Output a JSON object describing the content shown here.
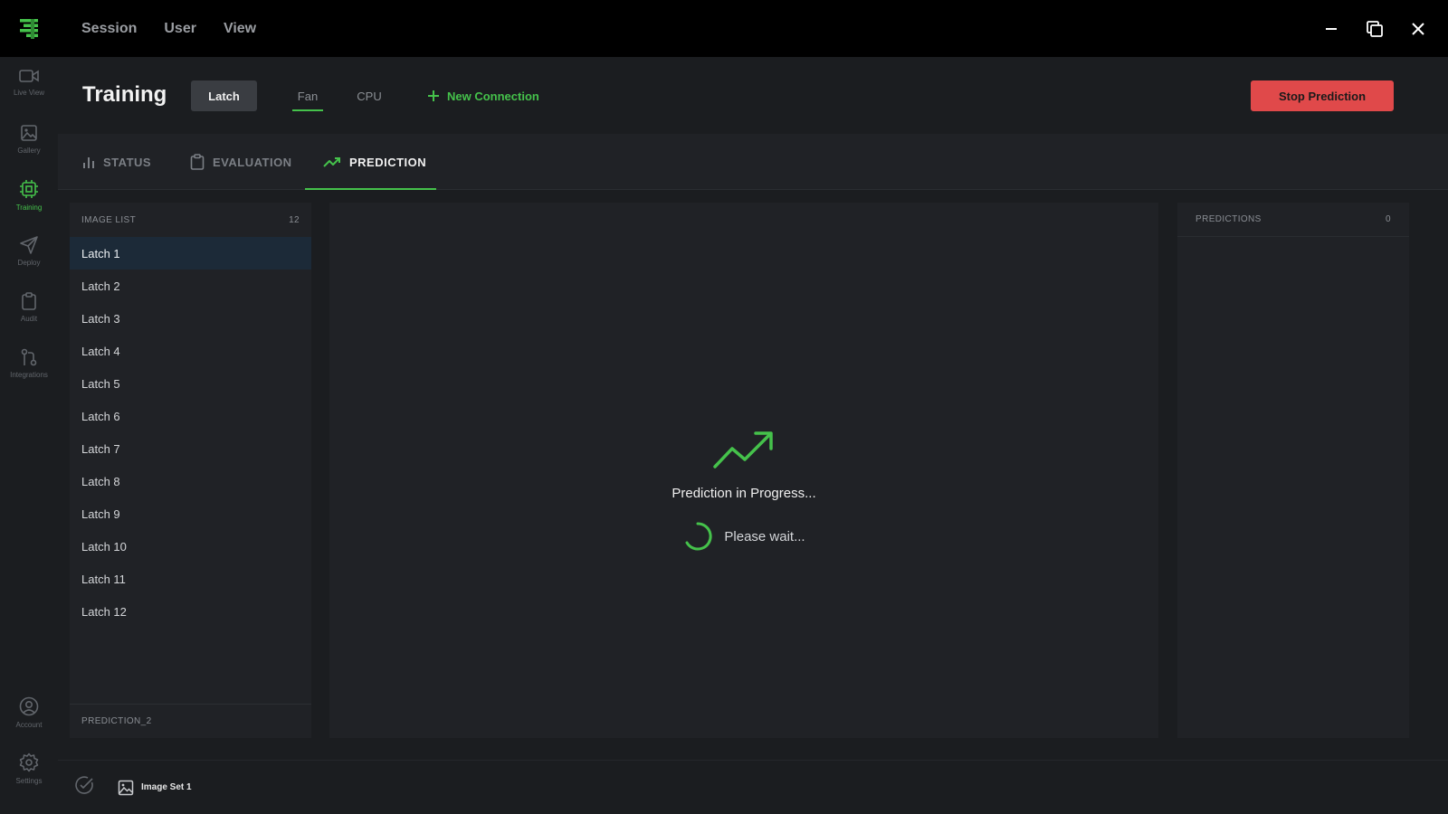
{
  "menu": {
    "session": "Session",
    "user": "User",
    "view": "View"
  },
  "sidebar": {
    "live_view": "Live View",
    "gallery": "Gallery",
    "training": "Training",
    "deploy": "Deploy",
    "audit": "Audit",
    "integrations": "Integrations",
    "account": "Account",
    "settings": "Settings"
  },
  "header": {
    "title": "Training",
    "tabs": [
      "Latch",
      "Fan",
      "CPU"
    ],
    "new_connection": "New Connection",
    "stop_button": "Stop Prediction"
  },
  "view_tabs": {
    "status": "STATUS",
    "evaluation": "EVALUATION",
    "prediction": "PREDICTION"
  },
  "image_list": {
    "title": "IMAGE LIST",
    "count": "12",
    "items": [
      "Latch 1",
      "Latch 2",
      "Latch 3",
      "Latch 4",
      "Latch 5",
      "Latch 6",
      "Latch 7",
      "Latch 8",
      "Latch 9",
      "Latch 10",
      "Latch 11",
      "Latch 12"
    ],
    "selected": "Latch 1",
    "footer": "PREDICTION_2"
  },
  "progress": {
    "title": "Prediction in Progress...",
    "wait": "Please wait..."
  },
  "predictions": {
    "title": "PREDICTIONS",
    "count": "0"
  },
  "status_bar": {
    "image_set": "Image Set 1"
  },
  "colors": {
    "accent": "#45c24b",
    "danger": "#e0494a",
    "selected_row": "#1c2a38"
  }
}
